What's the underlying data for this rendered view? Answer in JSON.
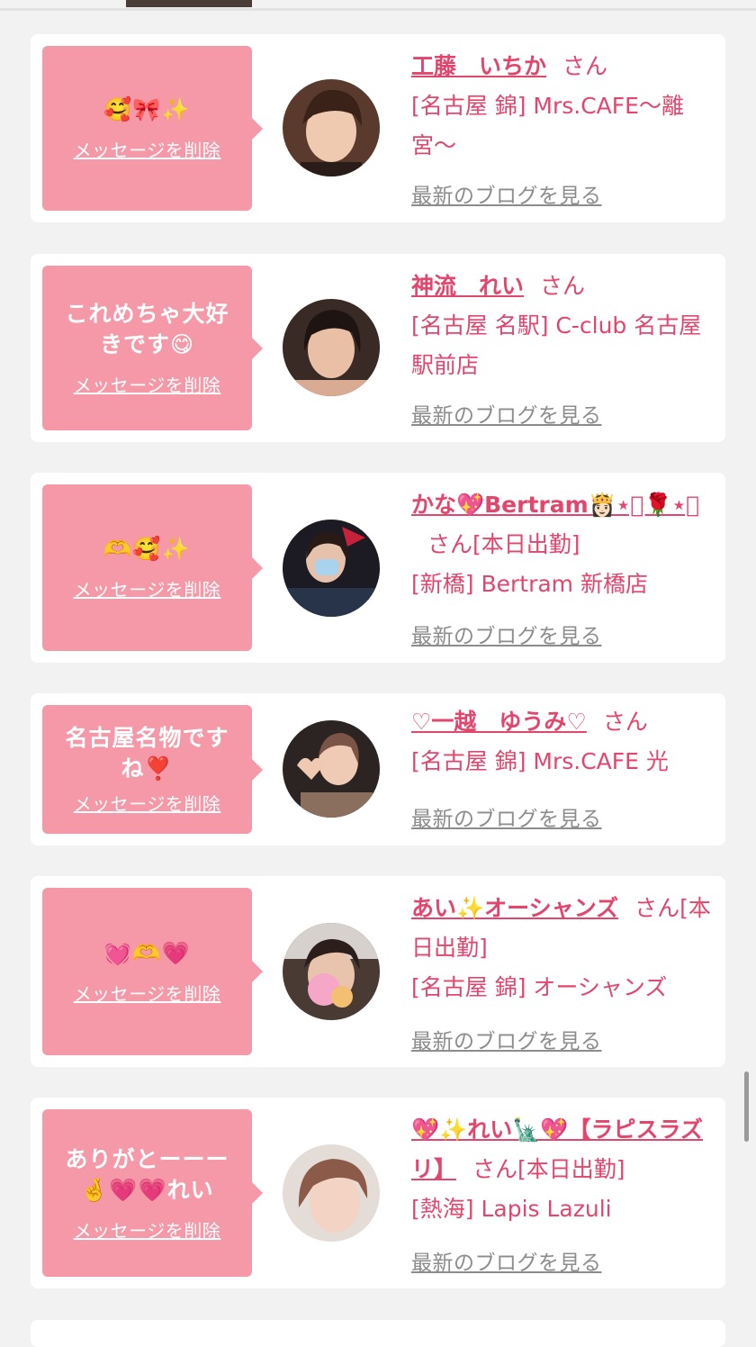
{
  "messages": [
    {
      "bubble_text": "🥰🎀✨",
      "delete_label": "メッセージを削除",
      "name": "工藤　いちか",
      "suffix": "さん",
      "shop": "[名古屋 錦] Mrs.CAFE〜離宮〜",
      "blog_label": "最新のブログを見る"
    },
    {
      "bubble_text": "これめちゃ大好きです😋",
      "delete_label": "メッセージを削除",
      "name": "神流　れい",
      "suffix": "さん",
      "shop": "[名古屋 名駅] C-club 名古屋駅前店",
      "blog_label": "最新のブログを見る"
    },
    {
      "bubble_text": "🫶🥰✨",
      "delete_label": "メッセージを削除",
      "name": "かな💖Bertram👸🏻⋆͛🌹⋆͛",
      "suffix": "さん[本日出勤]",
      "shop": "[新橋] Bertram 新橋店",
      "blog_label": "最新のブログを見る"
    },
    {
      "bubble_text": "名古屋名物ですね❣️",
      "delete_label": "メッセージを削除",
      "name": "♡一越　ゆうみ♡",
      "suffix": "さん",
      "shop": "[名古屋 錦] Mrs.CAFE 光",
      "blog_label": "最新のブログを見る"
    },
    {
      "bubble_text": "💓🫶💗",
      "delete_label": "メッセージを削除",
      "name": "あい✨オーシャンズ",
      "suffix": "さん[本日出勤]",
      "shop": "[名古屋 錦] オーシャンズ",
      "blog_label": "最新のブログを見る"
    },
    {
      "bubble_text": "ありがとーーー🤞💗💗れい",
      "delete_label": "メッセージを削除",
      "name": "💖✨れい🗽💖【ラピスラズリ】",
      "suffix": "さん[本日出勤]",
      "shop": "[熱海] Lapis Lazuli",
      "blog_label": "最新のブログを見る"
    }
  ]
}
